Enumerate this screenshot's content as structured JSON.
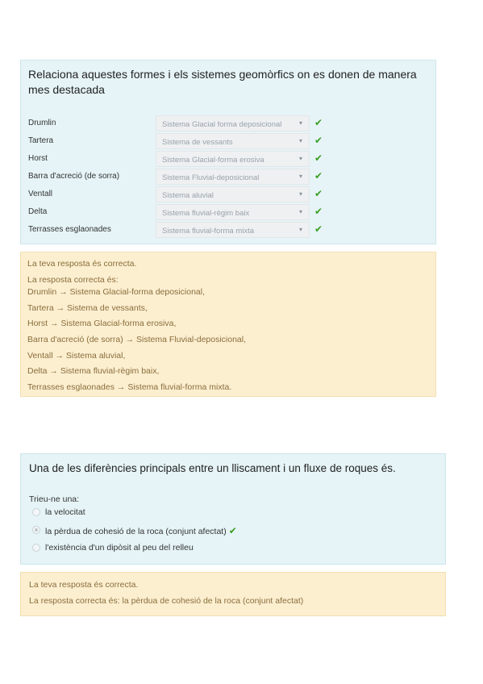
{
  "q1": {
    "title": "Relaciona aquestes formes i els sistemes geomòrfics on es donen de manera mes destacada",
    "rows": [
      {
        "label": "Drumlin",
        "selected": "Sistema Glacial forma deposicional"
      },
      {
        "label": "Tartera",
        "selected": "Sistema de vessants"
      },
      {
        "label": "Horst",
        "selected": "Sistema Glacial-forma erosiva"
      },
      {
        "label": "Barra d'acreció (de sorra)",
        "selected": "Sistema Fluvial-deposicional"
      },
      {
        "label": "Ventall",
        "selected": "Sistema aluvial"
      },
      {
        "label": "Delta",
        "selected": "Sistema fluvial-règim baix"
      },
      {
        "label": "Terrasses esglaonades",
        "selected": "Sistema fluvial-forma mixta"
      }
    ],
    "caret": "▾",
    "check": "✔",
    "feedback": [
      "La teva resposta és correcta.",
      "La resposta correcta és:",
      "Drumlin → Sistema Glacial-forma deposicional,",
      "Tartera → Sistema de vessants,",
      "Horst → Sistema Glacial-forma erosiva,",
      "Barra d'acreció (de sorra) → Sistema Fluvial-deposicional,",
      "Ventall → Sistema aluvial,",
      "Delta → Sistema fluvial-règim baix,",
      "Terrasses esglaonades → Sistema fluvial-forma mixta."
    ]
  },
  "q2": {
    "title": "Una de les diferències principals entre un lliscament i un fluxe de roques és.",
    "prompt": "Trieu-ne una:",
    "options": [
      {
        "text": "la velocitat",
        "selected": false
      },
      {
        "text": "la pèrdua de cohesió de la roca (conjunt afectat)",
        "selected": true
      },
      {
        "text": "l'existència d'un dipòsit al peu del relleu",
        "selected": false
      }
    ],
    "check": "✔",
    "feedback": [
      "La teva resposta és correcta.",
      "La resposta correcta és: la pèrdua de cohesió de la roca (conjunt afectat)"
    ]
  },
  "colors": {
    "question_bg": "#e6f4f7",
    "feedback_bg": "#fcefd0",
    "feedback_text": "#8a6d3b",
    "check": "#3a9d23"
  }
}
